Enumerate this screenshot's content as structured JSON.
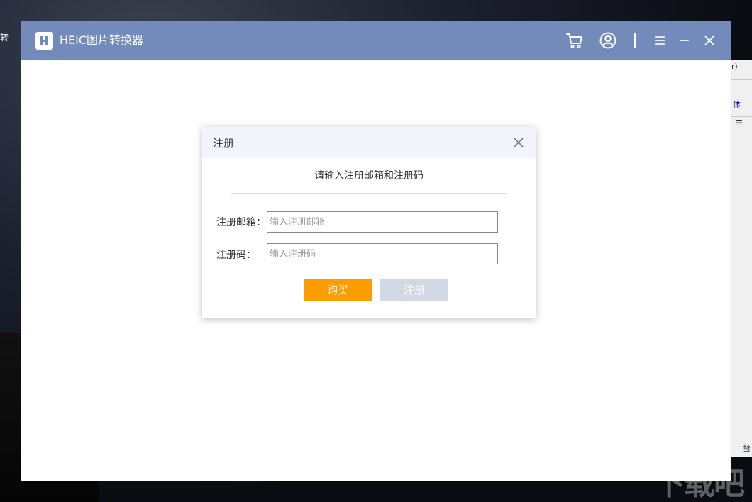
{
  "desktop": {
    "edge_char": "转",
    "watermark": "下载吧",
    "background_window": {
      "t1": "r)",
      "t2": "体",
      "t3": "彗"
    }
  },
  "app": {
    "title": "HEIC图片转换器",
    "colors": {
      "titlebar": "#728bba",
      "accent_buy": "#ff9d00",
      "disabled_button": "#d2d9e4"
    },
    "toolbar_icons": [
      "cart-icon",
      "user-icon",
      "menu-icon",
      "minimize-icon",
      "close-icon"
    ]
  },
  "dialog": {
    "title": "注册",
    "subtitle": "请输入注册邮箱和注册码",
    "email": {
      "label": "注册邮箱：",
      "value": "",
      "placeholder": "输入注册邮箱"
    },
    "code": {
      "label": "注册码：",
      "value": "",
      "placeholder": "输入注册码"
    },
    "buy_label": "购买",
    "register_label": "注册"
  }
}
